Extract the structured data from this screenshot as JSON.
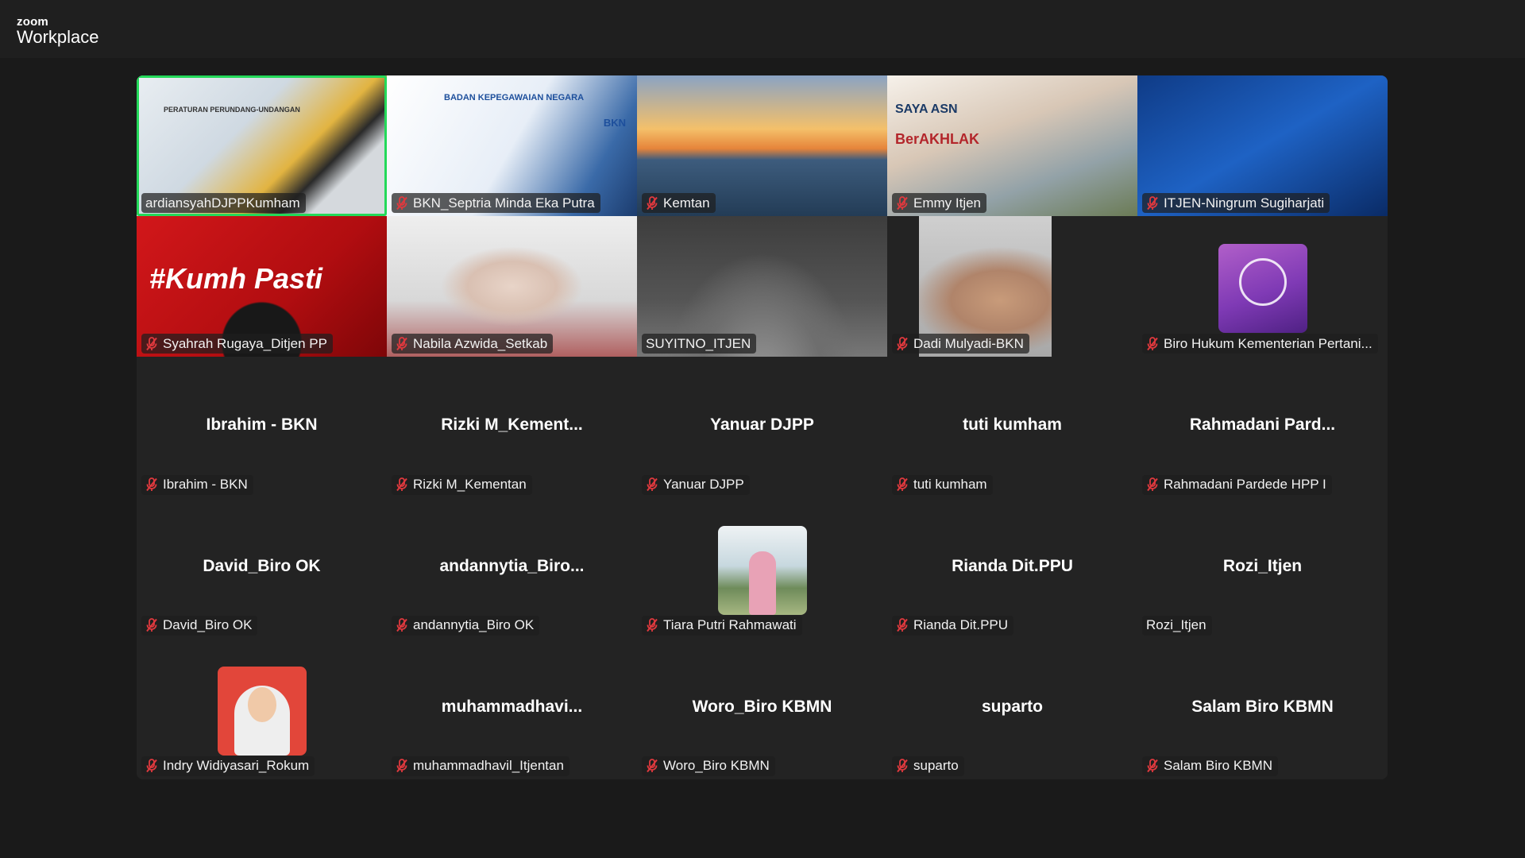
{
  "app": {
    "brand_top": "zoom",
    "brand_bottom": "Workplace"
  },
  "tiles": [
    {
      "label": "ardiansyahDJPPKumham",
      "big": "",
      "muted": false,
      "active": true,
      "style": "v1",
      "banner": "PERATURAN PERUNDANG-UNDANGAN"
    },
    {
      "label": "BKN_Septria Minda Eka Putra",
      "big": "",
      "muted": true,
      "active": false,
      "style": "v2",
      "banner": "BADAN KEPEGAWAIAN NEGARA",
      "banner2": "BKN"
    },
    {
      "label": "Kemtan",
      "big": "",
      "muted": true,
      "active": false,
      "style": "v3"
    },
    {
      "label": "Emmy Itjen",
      "big": "",
      "muted": true,
      "active": false,
      "style": "v4",
      "banner": "SAYA ASN",
      "banner2": "BerAKHLAK"
    },
    {
      "label": "ITJEN-Ningrum Sugiharjati",
      "big": "",
      "muted": true,
      "active": false,
      "style": "v5"
    },
    {
      "label": "Syahrah Rugaya_Ditjen PP",
      "big": "",
      "muted": true,
      "active": false,
      "style": "v6",
      "banner": "#Kumh   Pasti"
    },
    {
      "label": "Nabila Azwida_Setkab",
      "big": "",
      "muted": true,
      "active": false,
      "style": "v7"
    },
    {
      "label": "SUYITNO_ITJEN",
      "big": "",
      "muted": false,
      "active": false,
      "style": "v8"
    },
    {
      "label": "Dadi Mulyadi-BKN",
      "big": "",
      "muted": true,
      "active": false,
      "style": "v9"
    },
    {
      "label": "Biro Hukum Kementerian Pertani...",
      "big": "",
      "muted": true,
      "active": false,
      "style": "avatar-logo"
    },
    {
      "label": "Ibrahim - BKN",
      "big": "Ibrahim - BKN",
      "muted": true,
      "active": false
    },
    {
      "label": "Rizki M_Kementan",
      "big": "Rizki  M_Kement...",
      "muted": true,
      "active": false
    },
    {
      "label": "Yanuar DJPP",
      "big": "Yanuar DJPP",
      "muted": true,
      "active": false
    },
    {
      "label": "tuti kumham",
      "big": "tuti kumham",
      "muted": true,
      "active": false
    },
    {
      "label": "Rahmadani Pardede HPP I",
      "big": "Rahmadani  Pard...",
      "muted": true,
      "active": false
    },
    {
      "label": "David_Biro OK",
      "big": "David_Biro OK",
      "muted": true,
      "active": false
    },
    {
      "label": "andannytia_Biro OK",
      "big": "andannytia_Biro...",
      "muted": true,
      "active": false
    },
    {
      "label": "Tiara Putri Rahmawati",
      "big": "",
      "muted": true,
      "active": false,
      "style": "avatar-tiara"
    },
    {
      "label": "Rianda Dit.PPU",
      "big": "Rianda Dit.PPU",
      "muted": true,
      "active": false
    },
    {
      "label": "Rozi_Itjen",
      "big": "Rozi_Itjen",
      "muted": false,
      "active": false
    },
    {
      "label": "Indry Widiyasari_Rokum",
      "big": "",
      "muted": true,
      "active": false,
      "style": "avatar-indry"
    },
    {
      "label": "muhammadhavil_Itjentan",
      "big": "muhammadhavi...",
      "muted": true,
      "active": false
    },
    {
      "label": "Woro_Biro KBMN",
      "big": "Woro_Biro KBMN",
      "muted": true,
      "active": false
    },
    {
      "label": "suparto",
      "big": "suparto",
      "muted": true,
      "active": false
    },
    {
      "label": "Salam Biro KBMN",
      "big": "Salam Biro KBMN",
      "muted": true,
      "active": false
    }
  ],
  "colors": {
    "muted_mic": "#e0393e",
    "active_border": "#23d959",
    "background": "#1a1a1a"
  },
  "icons": {
    "mic_muted": "mic-muted-icon"
  }
}
